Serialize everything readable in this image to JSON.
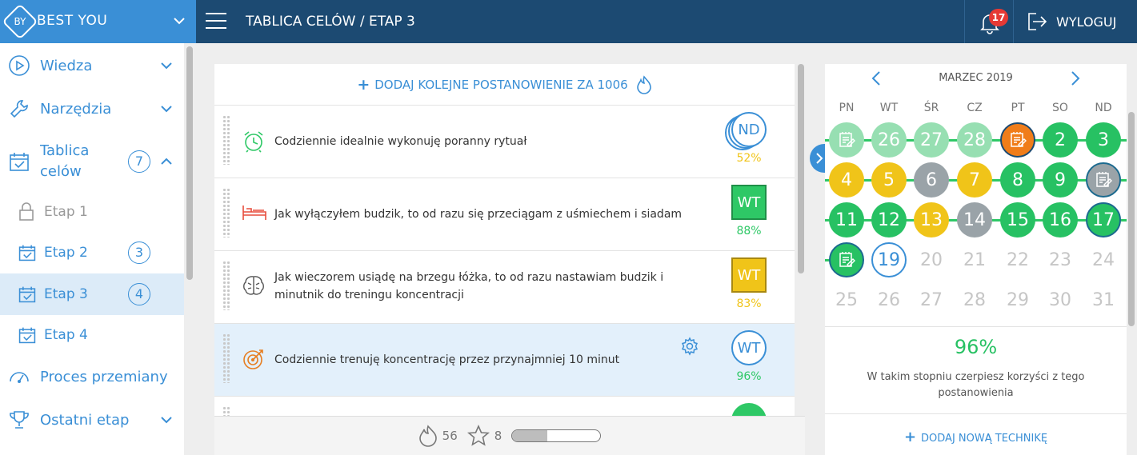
{
  "header": {
    "brand": "BEST YOU",
    "brand_mark": "BY",
    "title": "TABLICA CELÓW / ETAP 3",
    "notifications": "17",
    "logout": "WYLOGUJ"
  },
  "sidebar": {
    "items": [
      {
        "label": "Wiedza",
        "icon": "play-circle-icon"
      },
      {
        "label": "Narzędzia",
        "icon": "wrench-icon"
      },
      {
        "label": "Tablica\ncelów",
        "icon": "calendar-check-icon",
        "count": "7"
      },
      {
        "label": "Etap 1",
        "icon": "lock-icon"
      },
      {
        "label": "Etap 2",
        "icon": "calendar-check-icon",
        "count": "3"
      },
      {
        "label": "Etap 3",
        "icon": "calendar-check-icon",
        "count": "4"
      },
      {
        "label": "Etap 4",
        "icon": "calendar-check-icon"
      },
      {
        "label": "Proces przemiany",
        "icon": "gauge-icon"
      },
      {
        "label": "Ostatni etap",
        "icon": "trophy-icon"
      }
    ]
  },
  "goals": {
    "add_label": "DODAJ KOLEJNE POSTANOWIENIE ZA 1006",
    "items": [
      {
        "text": "Codziennie idealnie wykonuję poranny rytuał",
        "day": "ND",
        "pct": "52%",
        "icon": "alarm-clock-icon"
      },
      {
        "text": "Jak wyłączyłem budzik, to od razu się przeciągam z uśmiechem i siadam",
        "day": "WT",
        "pct": "88%",
        "icon": "bed-icon"
      },
      {
        "text": "Jak wieczorem usiądę na brzegu łóżka, to od razu nastawiam budzik i minutnik do treningu koncentracji",
        "day": "WT",
        "pct": "83%",
        "icon": "brain-icon"
      },
      {
        "text": "Codziennie trenuję koncentrację przez przynajmniej 10 minut",
        "day": "WT",
        "pct": "96%",
        "icon": "target-icon"
      }
    ],
    "colors": {
      "green": "#2ec866",
      "yellow": "#f0c419",
      "blue": "#3a8fd6"
    }
  },
  "footer": {
    "flames": "56",
    "stars": "8",
    "progress": 0.4
  },
  "calendar": {
    "month": "MARZEC 2019",
    "weekdays": [
      "PN",
      "WT",
      "ŚR",
      "CZ",
      "PT",
      "SO",
      "ND"
    ],
    "weeks": [
      [
        "",
        "26",
        "27",
        "28",
        "",
        "2",
        "3"
      ],
      [
        "4",
        "5",
        "6",
        "7",
        "8",
        "9",
        ""
      ],
      [
        "11",
        "12",
        "13",
        "14",
        "15",
        "16",
        "17"
      ],
      [
        "",
        "19",
        "20",
        "21",
        "22",
        "23",
        "24"
      ],
      [
        "25",
        "26",
        "27",
        "28",
        "29",
        "30",
        "31"
      ]
    ],
    "percent": "96%",
    "description": "W takim stopniu czerpiesz korzyści z tego postanowienia",
    "add_label": "DODAJ NOWĄ TECHNIKĘ"
  }
}
